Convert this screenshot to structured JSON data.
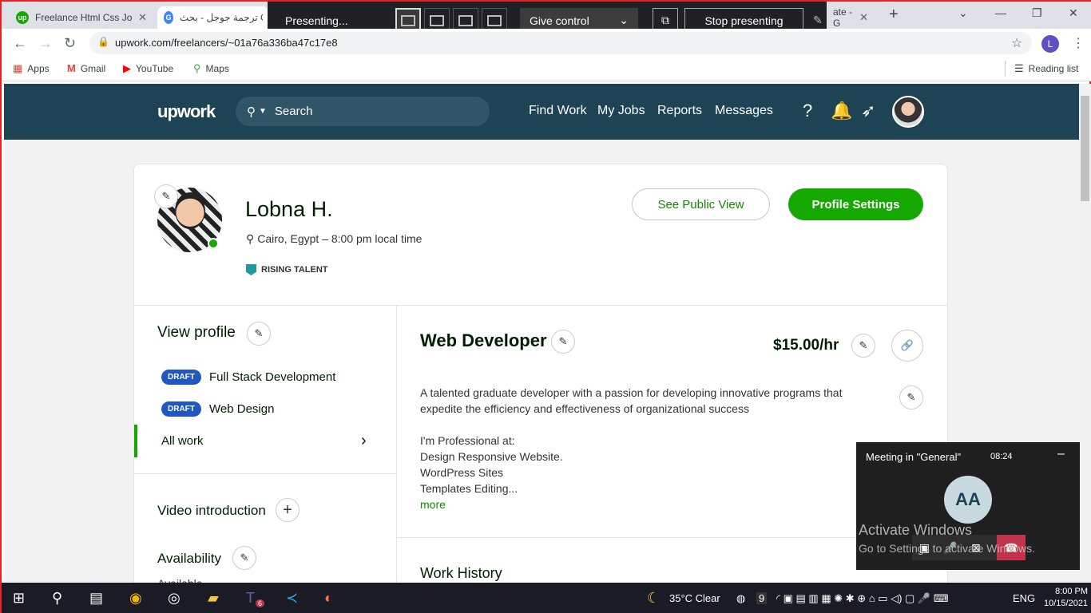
{
  "browser": {
    "tabs": [
      {
        "label": "Freelance Html Css Jo",
        "favicon": "upwork-icon"
      },
      {
        "label": "ترجمة جوجل - بحث Google",
        "favicon": "google-icon"
      },
      {
        "label": "ate - G",
        "favicon": "google-icon"
      }
    ],
    "new_tab": "+",
    "url": "upwork.com/freelancers/~01a76a336ba47c17e8",
    "profile_initial": "L",
    "bookmarks": [
      "Apps",
      "Gmail",
      "YouTube",
      "Maps"
    ],
    "reading_list": "Reading list"
  },
  "presenting_bar": {
    "status": "Presenting...",
    "give_control": "Give control",
    "stop_label": "Stop presenting"
  },
  "upwork_header": {
    "logo": "upwork",
    "search_placeholder": "Search",
    "nav": [
      "Find Work",
      "My Jobs",
      "Reports",
      "Messages"
    ]
  },
  "profile": {
    "name": "Lobna H.",
    "location": "Cairo, Egypt – 8:00 pm local time",
    "badge": "RISING TALENT",
    "see_public": "See Public View",
    "settings": "Profile Settings"
  },
  "sidebar": {
    "view_profile": "View profile",
    "specialties": [
      {
        "tag": "DRAFT",
        "label": "Full Stack Development"
      },
      {
        "tag": "DRAFT",
        "label": "Web Design"
      }
    ],
    "all_work": "All work",
    "video_intro": "Video introduction",
    "availability": "Availability",
    "availability_value": "Available"
  },
  "main": {
    "title": "Web Developer",
    "rate": "$15.00/hr",
    "desc_lines": [
      "A talented graduate developer with a passion for developing innovative programs that",
      "expedite the efficiency and effectiveness of organizational success",
      "",
      "I'm Professional at:",
      "Design Responsive Website.",
      "WordPress Sites",
      "Templates Editing..."
    ],
    "more": "more",
    "work_history": "Work History"
  },
  "meeting": {
    "title": "Meeting in \"General\"",
    "time": "08:24",
    "initials": "AA"
  },
  "watermark": {
    "line1": "Activate Windows",
    "line2": "Go to Settings to activate Windows."
  },
  "taskbar": {
    "weather": "35°C  Clear",
    "lang": "ENG",
    "time": "8:00 PM",
    "date": "10/15/2021",
    "teams_badge": "6",
    "tray_count": "9"
  }
}
